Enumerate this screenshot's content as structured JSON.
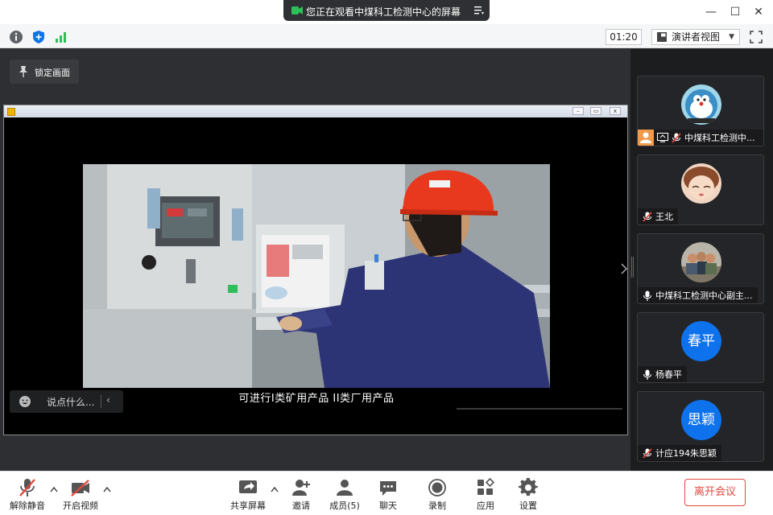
{
  "window": {
    "share_banner": "您正在观看中煤科工检测中心的屏幕",
    "minimize": "—",
    "maximize": "☐",
    "close": "✕"
  },
  "toolbar": {
    "timer": "01:20",
    "view_mode": "演讲者视图"
  },
  "stage": {
    "lock_label": "锁定画面",
    "subtitle": "可进行I类矿用产品 II类厂用产品",
    "chat_placeholder": "说点什么...",
    "chat_arrow": "‹"
  },
  "participants": [
    {
      "name": "中煤科工检测中...",
      "avatar": "image",
      "muted": true,
      "host": true,
      "sharing": true
    },
    {
      "name": "王北",
      "avatar": "image",
      "muted": true
    },
    {
      "name": "中煤科工检测中心副主...",
      "avatar": "image",
      "muted": false
    },
    {
      "name": "杨春平",
      "avatar_text": "春平",
      "muted": false
    },
    {
      "name": "计应194朱思颖",
      "avatar_text": "思颖",
      "muted": true
    }
  ],
  "controls": {
    "unmute": "解除静音",
    "start_video": "开启视频",
    "share_screen": "共享屏幕",
    "invite": "邀请",
    "members": "成员(5)",
    "chat": "聊天",
    "record": "录制",
    "apps": "应用",
    "settings": "设置",
    "leave": "离开会议"
  },
  "colors": {
    "accent_blue": "#0e72ed",
    "leave_red": "#e0483e",
    "mute_red": "#e0483e"
  }
}
